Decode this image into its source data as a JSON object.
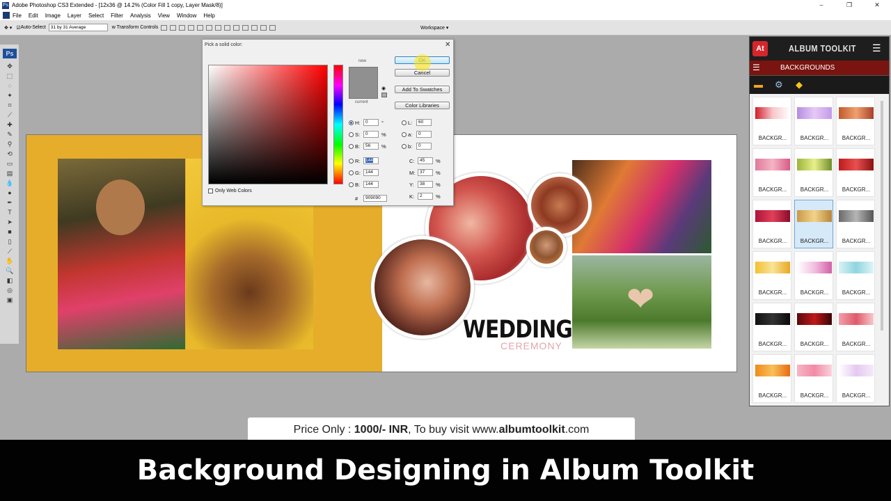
{
  "window": {
    "title": "Adobe Photoshop CS3 Extended - [12x36 @ 14.2% (Color Fill 1 copy, Layer Mask/8)]",
    "controls": [
      "–",
      "❐",
      "✕"
    ]
  },
  "menubar": [
    "File",
    "Edit",
    "Image",
    "Layer",
    "Select",
    "Filter",
    "Analysis",
    "View",
    "Window",
    "Help"
  ],
  "options_bar": {
    "auto_select": "Auto-Select",
    "sample_size": "31 by 31 Average",
    "transform_controls": "w Transform Controls",
    "workspace": "Workspace ▾"
  },
  "toolbox": {
    "logo": "Ps"
  },
  "canvas": {
    "title": "WEDDING",
    "subtitle": "CEREMONY"
  },
  "color_picker": {
    "title": "Pick a solid color:",
    "new_label": "new",
    "current_label": "current",
    "buttons": {
      "ok": "OK",
      "cancel": "Cancel",
      "add_swatches": "Add To Swatches",
      "color_libraries": "Color Libraries"
    },
    "only_web_colors": "Only Web Colors",
    "fields": {
      "H": "0",
      "S": "0",
      "B": "56",
      "R": "144",
      "G": "144",
      "Bl": "144",
      "L": "60",
      "a": "0",
      "b": "0",
      "C": "45",
      "M": "37",
      "Y": "38",
      "K": "2",
      "hex": "909090"
    },
    "units": {
      "deg": "°",
      "pct": "%"
    },
    "swatch_color": "#909090"
  },
  "panel": {
    "logo": "At",
    "title": "ALBUM TOOLKIT",
    "section": "BACKGROUNDS",
    "thumb_label": "BACKGR...",
    "accent": "#7a1410"
  },
  "price": {
    "prefix": "Price Only : ",
    "amount": "1000/- INR",
    "mid": ", To buy visit www.",
    "domain": "albumtoolkit",
    "suffix": ".com"
  },
  "banner": "Background Designing in Album Toolkit"
}
